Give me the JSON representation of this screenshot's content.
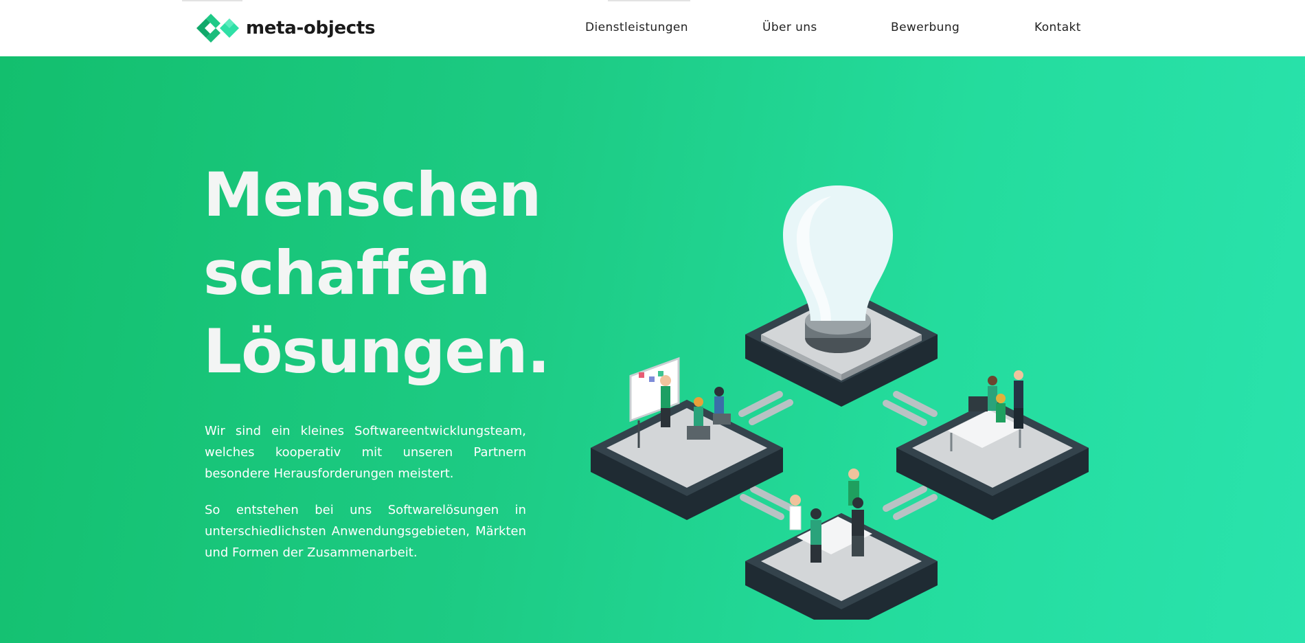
{
  "header": {
    "logo_text": "meta-objects",
    "nav": [
      {
        "label": "Dienstleistungen"
      },
      {
        "label": "Über uns"
      },
      {
        "label": "Bewerbung"
      },
      {
        "label": "Kontakt"
      }
    ]
  },
  "hero": {
    "title_lines": [
      "Menschen",
      "schaffen",
      "Lösungen."
    ],
    "paragraphs": [
      "Wir sind ein kleines Softwareentwicklungsteam, welches kooperativ mit unseren Partnern besondere Herausforderungen meistert.",
      "So entstehen bei uns Softwarelösungen in unterschiedlichsten Anwendungsgebieten, Märkten und Formen der Zusammenarbeit."
    ]
  },
  "colors": {
    "brand_green": "#1dcb84",
    "hero_gradient_start": "#13bf6e",
    "hero_gradient_end": "#2ae3ad",
    "logo_dark": "#11a86a",
    "logo_light": "#2fe0a6"
  }
}
